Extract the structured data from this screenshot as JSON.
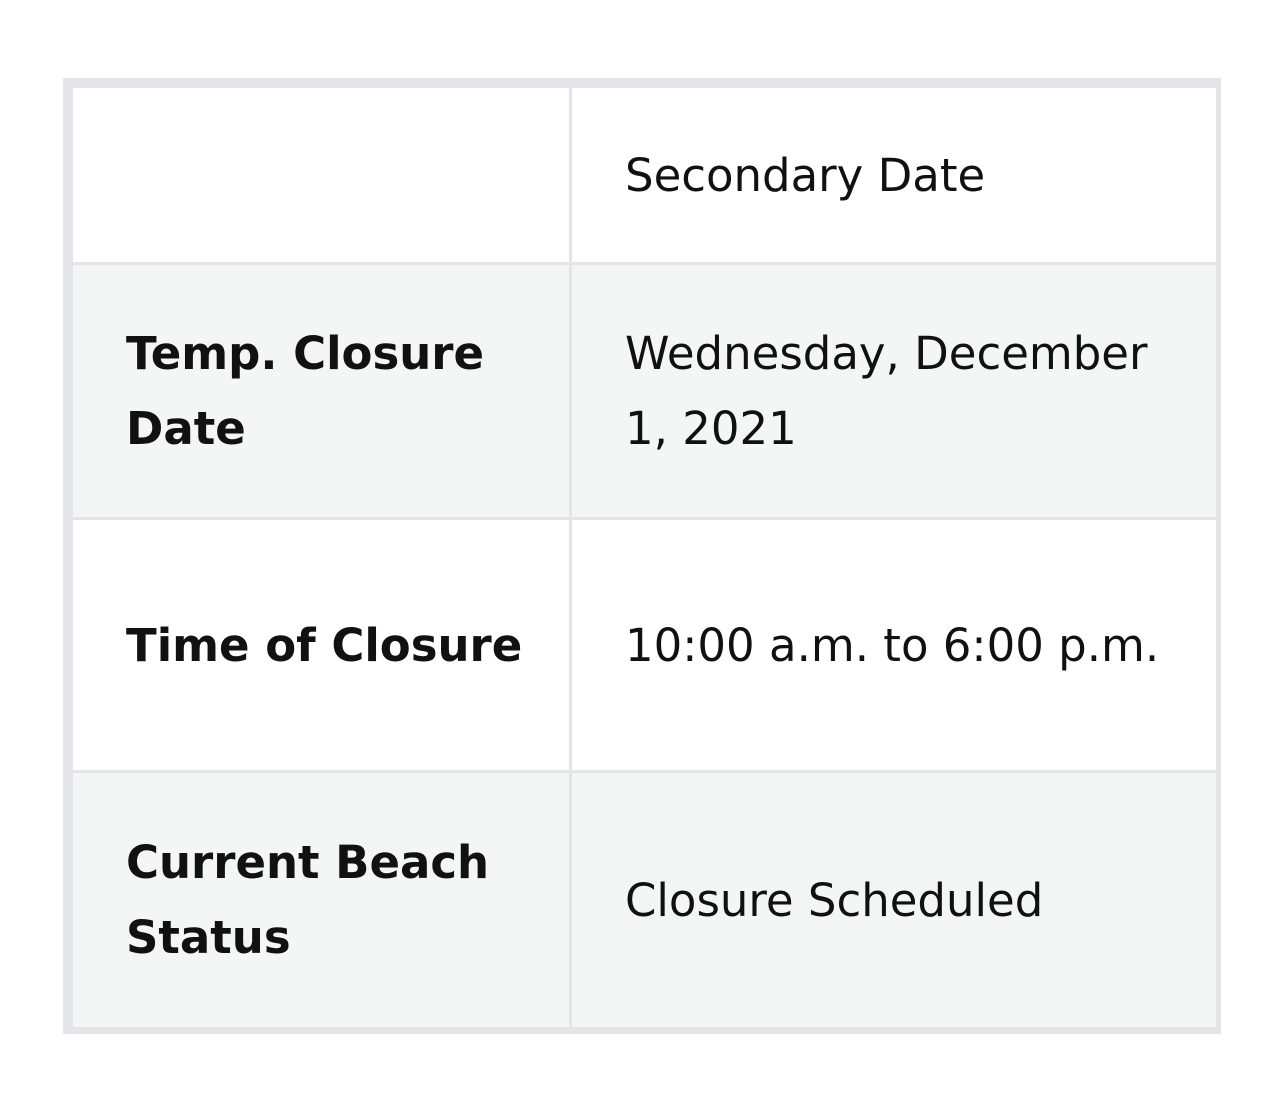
{
  "table": {
    "header": {
      "empty": "",
      "secondary_date_label": "Secondary Date"
    },
    "rows": [
      {
        "label": "Temp. Closure Date",
        "value": "Wednesday, December 1, 2021"
      },
      {
        "label": "Time of Closure",
        "value": "10:00 a.m. to 6:00 p.m."
      },
      {
        "label": "Current Beach Status",
        "value": "Closure Scheduled"
      }
    ]
  }
}
